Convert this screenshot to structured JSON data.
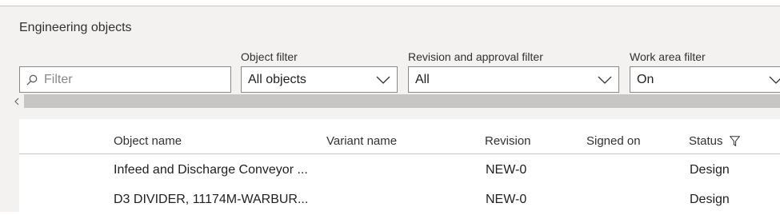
{
  "section": {
    "title": "Engineering objects"
  },
  "filters": {
    "search": {
      "placeholder": "Filter",
      "icon": "search-icon"
    },
    "object_filter": {
      "label": "Object filter",
      "value": "All objects"
    },
    "revision_filter": {
      "label": "Revision and approval filter",
      "value": "All"
    },
    "work_area_filter": {
      "label": "Work area filter",
      "value": "On"
    }
  },
  "grid": {
    "columns": [
      "Object name",
      "Variant name",
      "Revision",
      "Signed on",
      "Status"
    ],
    "rows": [
      {
        "object_name": "Infeed and Discharge Conveyor ...",
        "variant_name": "",
        "revision": "NEW-0",
        "signed_on": "",
        "status": "Design"
      },
      {
        "object_name": "D3 DIVIDER, 11174M-WARBUR...",
        "variant_name": "",
        "revision": "NEW-0",
        "signed_on": "",
        "status": "Design"
      }
    ]
  },
  "colors": {
    "panel_bg": "#f3f2f1",
    "border": "#8a8886",
    "scrollbar": "#c8c6c4"
  }
}
